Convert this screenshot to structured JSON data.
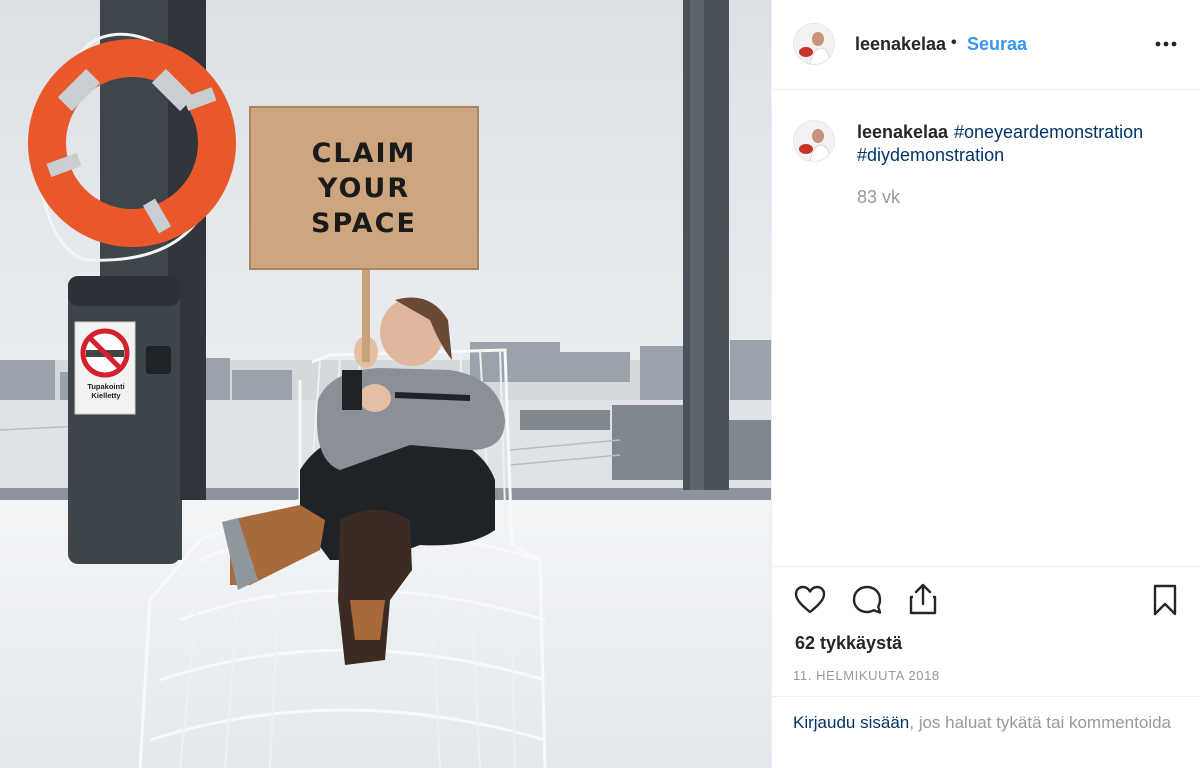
{
  "photo": {
    "sign_text": "CLAIM\nYOUR\nSPACE",
    "nosmoke_text": "Tupakointi\nKielletty"
  },
  "header": {
    "username": "leenakelaa",
    "separator": "•",
    "follow_label": "Seuraa"
  },
  "caption": {
    "username": "leenakelaa",
    "hashtags": [
      "#oneyeardemonstration",
      "#diydemonstration"
    ],
    "time_ago": "83 vk"
  },
  "actions": {
    "icons": [
      "heart-icon",
      "comment-icon",
      "share-icon",
      "bookmark-icon"
    ],
    "likes": "62 tykkäystä",
    "date": "11. HELMIKUUTA 2018"
  },
  "login": {
    "link_text": "Kirjaudu sisään",
    "rest_text": ", jos haluat tykätä tai kommentoida"
  },
  "colors": {
    "link_blue": "#3897f0",
    "hashtag_navy": "#003569",
    "muted_gray": "#999999",
    "lifebuoy_orange": "#e8582a"
  }
}
